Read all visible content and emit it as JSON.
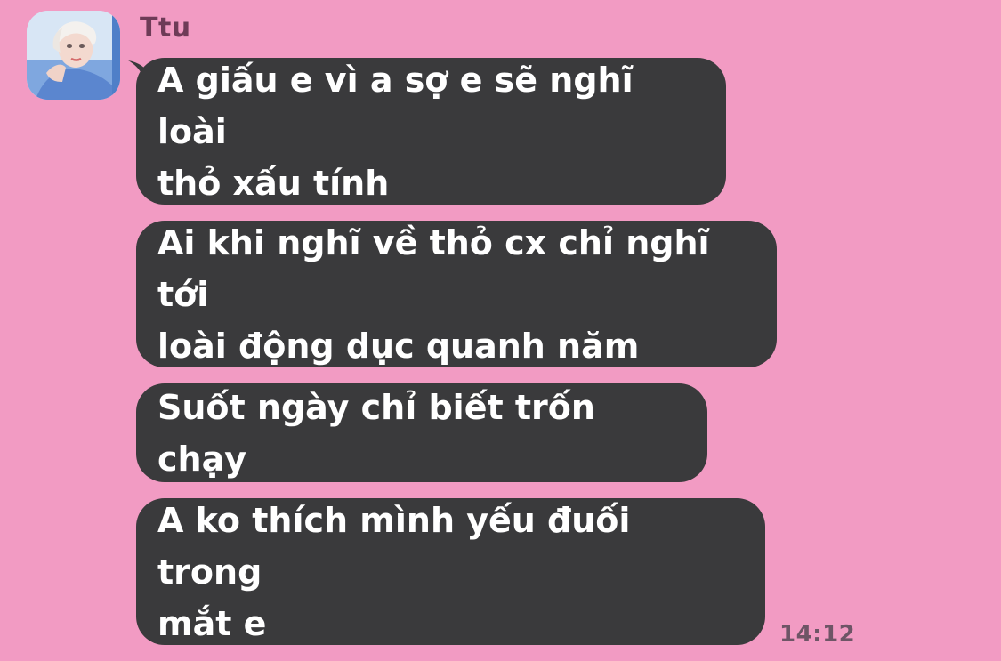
{
  "chat": {
    "sender_name": "Ttu",
    "messages": [
      {
        "text": "A giấu e vì a sợ e sẽ nghĩ loài\nthỏ xấu tính"
      },
      {
        "text": "Ai khi nghĩ về thỏ cx chỉ nghĩ tới\nloài động dục quanh năm"
      },
      {
        "text": "Suốt ngày chỉ biết trốn chạy"
      },
      {
        "text": "A ko thích mình yếu đuối trong\nmắt e"
      }
    ],
    "timestamp": "14:12"
  },
  "colors": {
    "background": "#f29bc3",
    "bubble": "#3a3a3c",
    "bubble_text": "#ffffff",
    "sender_name": "#6e3b57",
    "timestamp": "#6e5566"
  },
  "icons": {
    "avatar": "user-avatar-photo"
  }
}
